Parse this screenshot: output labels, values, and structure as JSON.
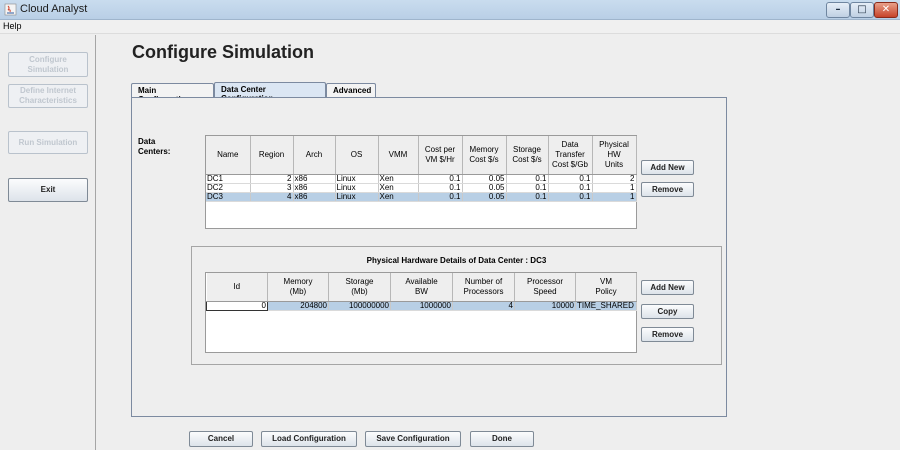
{
  "window": {
    "title": "Cloud Analyst"
  },
  "menubar": {
    "items": [
      "Help"
    ]
  },
  "sidebar": {
    "buttons": [
      {
        "label": "Configure\nSimulation",
        "enabled": false
      },
      {
        "label": "Define Internet\nCharacteristics",
        "enabled": false
      },
      {
        "label": "Run Simulation",
        "enabled": false
      },
      {
        "label": "Exit",
        "enabled": true
      }
    ]
  },
  "main": {
    "heading": "Configure Simulation",
    "tabs": [
      {
        "label": "Main Configuration",
        "active": false
      },
      {
        "label": "Data Center Configuration",
        "active": true
      },
      {
        "label": "Advanced",
        "active": false
      }
    ],
    "data_centers_label": "Data\nCenters:"
  },
  "dc_table": {
    "headers": [
      "Name",
      "Region",
      "Arch",
      "OS",
      "VMM",
      "Cost per\nVM $/Hr",
      "Memory\nCost $/s",
      "Storage\nCost $/s",
      "Data\nTransfer\nCost $/Gb",
      "Physical\nHW\nUnits"
    ],
    "rows": [
      [
        "DC1",
        "2",
        "x86",
        "Linux",
        "Xen",
        "0.1",
        "0.05",
        "0.1",
        "0.1",
        "2"
      ],
      [
        "DC2",
        "3",
        "x86",
        "Linux",
        "Xen",
        "0.1",
        "0.05",
        "0.1",
        "0.1",
        "1"
      ],
      [
        "DC3",
        "4",
        "x86",
        "Linux",
        "Xen",
        "0.1",
        "0.05",
        "0.1",
        "0.1",
        "1"
      ]
    ],
    "selected_row": 2,
    "add_label": "Add New",
    "remove_label": "Remove"
  },
  "hw": {
    "title_prefix": "Physical Hardware Details of Data Center : ",
    "title_dc": "DC3",
    "headers": [
      "Id",
      "Memory\n(Mb)",
      "Storage\n(Mb)",
      "Available\nBW",
      "Number of\nProcessors",
      "Processor\nSpeed",
      "VM\nPolicy"
    ],
    "rows": [
      [
        "0",
        "204800",
        "100000000",
        "1000000",
        "4",
        "10000",
        "TIME_SHARED"
      ]
    ],
    "add_label": "Add New",
    "copy_label": "Copy",
    "remove_label": "Remove"
  },
  "footer": {
    "cancel": "Cancel",
    "load": "Load Configuration",
    "save": "Save Configuration",
    "done": "Done"
  },
  "colors": {
    "selection": "#b8cfe5",
    "titlebar": "#c9dcee",
    "close": "#c7432a"
  }
}
